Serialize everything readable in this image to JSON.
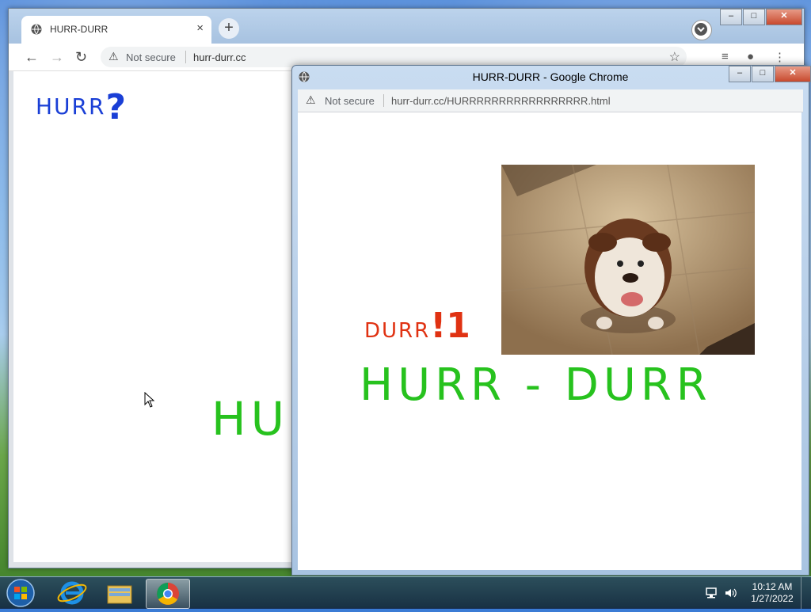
{
  "back_window": {
    "tab_title": "HURR-DURR",
    "tab_close": "×",
    "new_tab": "+",
    "not_secure": "Not secure",
    "url": "hurr-durr.cc",
    "page_hurr": "HURR",
    "page_q": "?",
    "page_big_text": "HU",
    "controls": {
      "minimize": "–",
      "maximize": "□",
      "close": "✕"
    }
  },
  "front_window": {
    "title": "HURR-DURR - Google Chrome",
    "not_secure": "Not secure",
    "url": "hurr-durr.cc/HURRRRRRRRRRRRRRRRR.html",
    "durr_word": "DURR",
    "durr_excl": "!1",
    "headline": "HURR - DURR",
    "controls": {
      "minimize": "–",
      "maximize": "□",
      "close": "✕"
    }
  },
  "taskbar": {
    "time": "10:12 AM",
    "date": "1/27/2022",
    "apps": [
      "start-button",
      "internet-explorer",
      "file-explorer",
      "google-chrome"
    ]
  },
  "colors": {
    "hurr_blue": "#1a3fd6",
    "durr_red": "#e03212",
    "headline_green": "#27c21e"
  }
}
